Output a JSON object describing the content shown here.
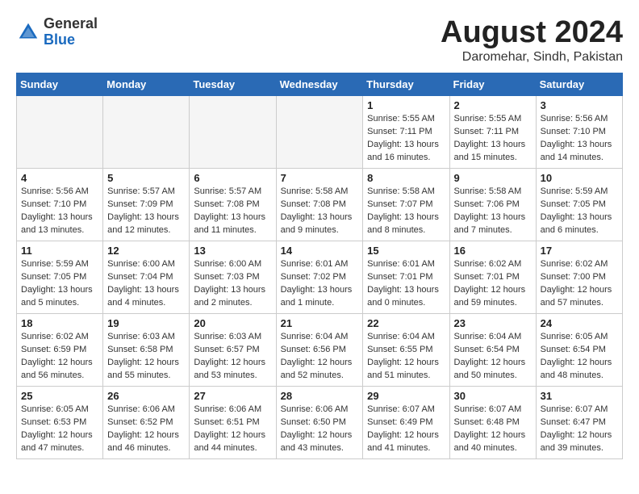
{
  "header": {
    "logo_line1": "General",
    "logo_line2": "Blue",
    "month": "August 2024",
    "location": "Daromehar, Sindh, Pakistan"
  },
  "weekdays": [
    "Sunday",
    "Monday",
    "Tuesday",
    "Wednesday",
    "Thursday",
    "Friday",
    "Saturday"
  ],
  "weeks": [
    [
      {
        "day": "",
        "info": ""
      },
      {
        "day": "",
        "info": ""
      },
      {
        "day": "",
        "info": ""
      },
      {
        "day": "",
        "info": ""
      },
      {
        "day": "1",
        "info": "Sunrise: 5:55 AM\nSunset: 7:11 PM\nDaylight: 13 hours\nand 16 minutes."
      },
      {
        "day": "2",
        "info": "Sunrise: 5:55 AM\nSunset: 7:11 PM\nDaylight: 13 hours\nand 15 minutes."
      },
      {
        "day": "3",
        "info": "Sunrise: 5:56 AM\nSunset: 7:10 PM\nDaylight: 13 hours\nand 14 minutes."
      }
    ],
    [
      {
        "day": "4",
        "info": "Sunrise: 5:56 AM\nSunset: 7:10 PM\nDaylight: 13 hours\nand 13 minutes."
      },
      {
        "day": "5",
        "info": "Sunrise: 5:57 AM\nSunset: 7:09 PM\nDaylight: 13 hours\nand 12 minutes."
      },
      {
        "day": "6",
        "info": "Sunrise: 5:57 AM\nSunset: 7:08 PM\nDaylight: 13 hours\nand 11 minutes."
      },
      {
        "day": "7",
        "info": "Sunrise: 5:58 AM\nSunset: 7:08 PM\nDaylight: 13 hours\nand 9 minutes."
      },
      {
        "day": "8",
        "info": "Sunrise: 5:58 AM\nSunset: 7:07 PM\nDaylight: 13 hours\nand 8 minutes."
      },
      {
        "day": "9",
        "info": "Sunrise: 5:58 AM\nSunset: 7:06 PM\nDaylight: 13 hours\nand 7 minutes."
      },
      {
        "day": "10",
        "info": "Sunrise: 5:59 AM\nSunset: 7:05 PM\nDaylight: 13 hours\nand 6 minutes."
      }
    ],
    [
      {
        "day": "11",
        "info": "Sunrise: 5:59 AM\nSunset: 7:05 PM\nDaylight: 13 hours\nand 5 minutes."
      },
      {
        "day": "12",
        "info": "Sunrise: 6:00 AM\nSunset: 7:04 PM\nDaylight: 13 hours\nand 4 minutes."
      },
      {
        "day": "13",
        "info": "Sunrise: 6:00 AM\nSunset: 7:03 PM\nDaylight: 13 hours\nand 2 minutes."
      },
      {
        "day": "14",
        "info": "Sunrise: 6:01 AM\nSunset: 7:02 PM\nDaylight: 13 hours\nand 1 minute."
      },
      {
        "day": "15",
        "info": "Sunrise: 6:01 AM\nSunset: 7:01 PM\nDaylight: 13 hours\nand 0 minutes."
      },
      {
        "day": "16",
        "info": "Sunrise: 6:02 AM\nSunset: 7:01 PM\nDaylight: 12 hours\nand 59 minutes."
      },
      {
        "day": "17",
        "info": "Sunrise: 6:02 AM\nSunset: 7:00 PM\nDaylight: 12 hours\nand 57 minutes."
      }
    ],
    [
      {
        "day": "18",
        "info": "Sunrise: 6:02 AM\nSunset: 6:59 PM\nDaylight: 12 hours\nand 56 minutes."
      },
      {
        "day": "19",
        "info": "Sunrise: 6:03 AM\nSunset: 6:58 PM\nDaylight: 12 hours\nand 55 minutes."
      },
      {
        "day": "20",
        "info": "Sunrise: 6:03 AM\nSunset: 6:57 PM\nDaylight: 12 hours\nand 53 minutes."
      },
      {
        "day": "21",
        "info": "Sunrise: 6:04 AM\nSunset: 6:56 PM\nDaylight: 12 hours\nand 52 minutes."
      },
      {
        "day": "22",
        "info": "Sunrise: 6:04 AM\nSunset: 6:55 PM\nDaylight: 12 hours\nand 51 minutes."
      },
      {
        "day": "23",
        "info": "Sunrise: 6:04 AM\nSunset: 6:54 PM\nDaylight: 12 hours\nand 50 minutes."
      },
      {
        "day": "24",
        "info": "Sunrise: 6:05 AM\nSunset: 6:54 PM\nDaylight: 12 hours\nand 48 minutes."
      }
    ],
    [
      {
        "day": "25",
        "info": "Sunrise: 6:05 AM\nSunset: 6:53 PM\nDaylight: 12 hours\nand 47 minutes."
      },
      {
        "day": "26",
        "info": "Sunrise: 6:06 AM\nSunset: 6:52 PM\nDaylight: 12 hours\nand 46 minutes."
      },
      {
        "day": "27",
        "info": "Sunrise: 6:06 AM\nSunset: 6:51 PM\nDaylight: 12 hours\nand 44 minutes."
      },
      {
        "day": "28",
        "info": "Sunrise: 6:06 AM\nSunset: 6:50 PM\nDaylight: 12 hours\nand 43 minutes."
      },
      {
        "day": "29",
        "info": "Sunrise: 6:07 AM\nSunset: 6:49 PM\nDaylight: 12 hours\nand 41 minutes."
      },
      {
        "day": "30",
        "info": "Sunrise: 6:07 AM\nSunset: 6:48 PM\nDaylight: 12 hours\nand 40 minutes."
      },
      {
        "day": "31",
        "info": "Sunrise: 6:07 AM\nSunset: 6:47 PM\nDaylight: 12 hours\nand 39 minutes."
      }
    ]
  ]
}
